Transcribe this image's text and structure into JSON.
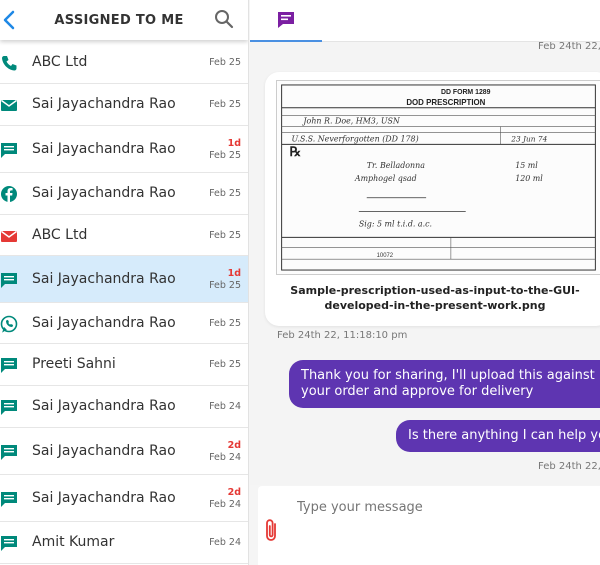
{
  "sidebar": {
    "title": "ASSIGNED TO ME",
    "conversations": [
      {
        "name": "ABC Ltd",
        "date": "Feb 25",
        "badge": "",
        "channel": "phone-icon",
        "color": "#00897b"
      },
      {
        "name": "Sai Jayachandra Rao",
        "date": "Feb 25",
        "badge": "",
        "channel": "email-icon",
        "color": "#00897b"
      },
      {
        "name": "Sai Jayachandra Rao",
        "date": "Feb 25",
        "badge": "1d",
        "channel": "chat-icon",
        "color": "#00897b"
      },
      {
        "name": "Sai Jayachandra Rao",
        "date": "Feb 25",
        "badge": "",
        "channel": "facebook-icon",
        "color": "#00897b"
      },
      {
        "name": "ABC Ltd",
        "date": "Feb 25",
        "badge": "",
        "channel": "gmail-icon",
        "color": "#e53935"
      },
      {
        "name": "Sai Jayachandra Rao",
        "date": "Feb 25",
        "badge": "1d",
        "channel": "chat-icon",
        "color": "#00897b",
        "selected": true
      },
      {
        "name": "Sai Jayachandra Rao",
        "date": "Feb 25",
        "badge": "",
        "channel": "whatsapp-icon",
        "color": "#00897b"
      },
      {
        "name": "Preeti Sahni",
        "date": "Feb 25",
        "badge": "",
        "channel": "chat-icon",
        "color": "#00897b"
      },
      {
        "name": "Sai Jayachandra Rao",
        "date": "Feb 24",
        "badge": "",
        "channel": "chat-icon",
        "color": "#00897b"
      },
      {
        "name": "Sai Jayachandra Rao",
        "date": "Feb 24",
        "badge": "2d",
        "channel": "chat-icon",
        "color": "#00897b"
      },
      {
        "name": "Sai Jayachandra Rao",
        "date": "Feb 24",
        "badge": "2d",
        "channel": "chat-icon",
        "color": "#00897b"
      },
      {
        "name": "Amit Kumar",
        "date": "Feb 24",
        "badge": "",
        "channel": "chat-icon",
        "color": "#00897b"
      }
    ]
  },
  "chat": {
    "tab_icon": "chat-bubble-icon",
    "accent": "#5e35b1",
    "messages": {
      "ts_top": "Feb 24th 22,",
      "attachment_caption": "Sample-prescription-used-as-input-to-the-GUI-developed-in-the-present-work.png",
      "attachment_ts": "Feb 24th 22, 11:18:10 pm",
      "msg1": "Thank you for sharing, I'll upload this against your order and approve for delivery",
      "msg2": "Is there anything I can help you with?",
      "ts_bottom": "Feb 24th 22,"
    },
    "composer_placeholder": "Type your message"
  },
  "prescription": {
    "form_no": "DD FORM 1289",
    "heading": "DOD PRESCRIPTION",
    "patient": "John R. Doe, HM3, USN",
    "facility": "U.S.S. Neverforgotten (DD 178)",
    "date": "23 Jun 74",
    "rx1": "Tr. Belladonna",
    "rx1_qty": "15 ml",
    "rx2": "Amphogel qsad",
    "rx2_qty": "120 ml",
    "sig": "Sig: 5 ml t.i.d. a.c.",
    "serial": "10072"
  }
}
